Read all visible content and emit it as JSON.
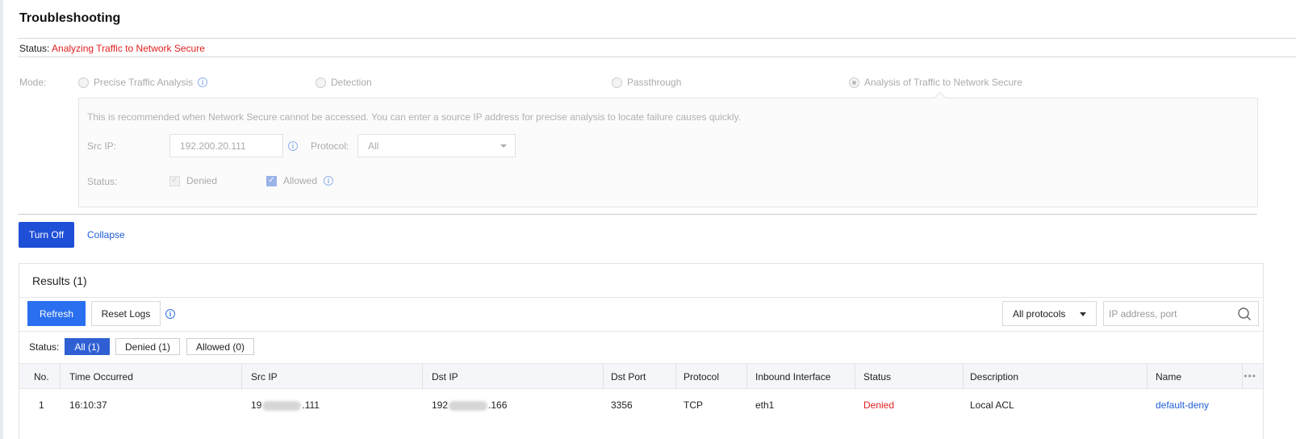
{
  "header": {
    "title": "Troubleshooting"
  },
  "status": {
    "label": "Status:",
    "value": "Analyzing Traffic to Network Secure"
  },
  "mode": {
    "label": "Mode:",
    "options": [
      {
        "label": "Precise Traffic Analysis",
        "selected": false
      },
      {
        "label": "Detection",
        "selected": false
      },
      {
        "label": "Passthrough",
        "selected": false
      },
      {
        "label": "Analysis of Traffic to Network Secure",
        "selected": true
      }
    ],
    "description": "This is recommended when Network Secure cannot be accessed. You can enter a source IP address for precise analysis to locate failure causes quickly.",
    "src_ip_label": "Src IP:",
    "src_ip_value": "192.200.20.111",
    "protocol_label": "Protocol:",
    "protocol_value": "All",
    "status_label": "Status:",
    "denied_label": "Denied",
    "allowed_label": "Allowed"
  },
  "actions": {
    "turn_off": "Turn Off",
    "collapse": "Collapse"
  },
  "results": {
    "title": "Results (1)",
    "refresh": "Refresh",
    "reset_logs": "Reset Logs",
    "protocol_filter": "All protocols",
    "search_placeholder": "IP address, port",
    "status_label": "Status:",
    "filters": [
      {
        "label": "All (1)",
        "active": true
      },
      {
        "label": "Denied (1)",
        "active": false
      },
      {
        "label": "Allowed (0)",
        "active": false
      }
    ],
    "columns": [
      "No.",
      "Time Occurred",
      "Src IP",
      "Dst IP",
      "Dst Port",
      "Protocol",
      "Inbound Interface",
      "Status",
      "Description",
      "Name"
    ],
    "rows": [
      {
        "no": "1",
        "time": "16:10:37",
        "src_ip_prefix": "19",
        "src_ip_suffix": ".111",
        "dst_ip_prefix": "192",
        "dst_ip_suffix": ".166",
        "dst_port": "3356",
        "protocol": "TCP",
        "interface": "eth1",
        "status": "Denied",
        "description": "Local ACL",
        "name": "default-deny"
      }
    ]
  },
  "colors": {
    "primary": "#1f4fd6",
    "refresh": "#2a6fef",
    "denied": "#e02020",
    "link": "#1f5ed6"
  }
}
